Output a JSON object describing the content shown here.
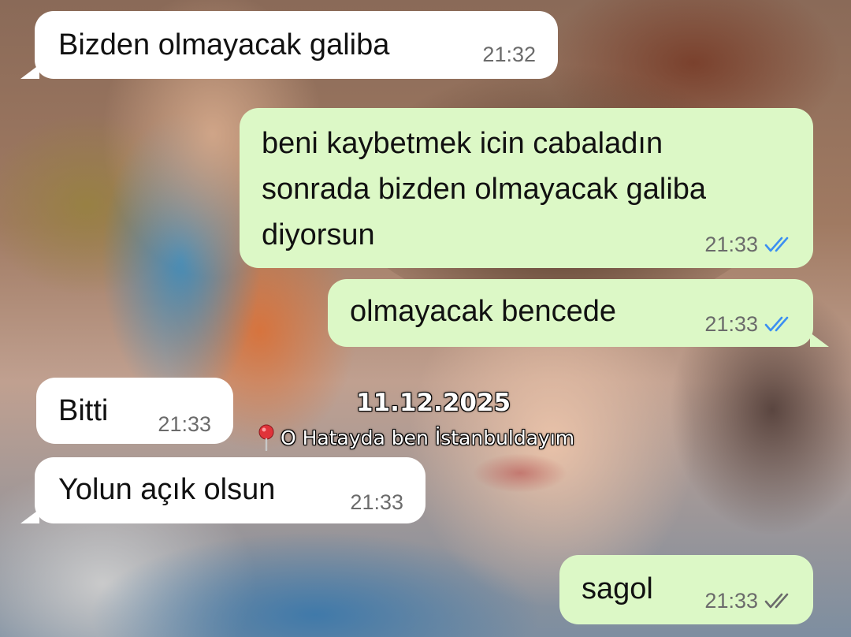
{
  "messages": [
    {
      "side": "incoming",
      "lines": [
        "Bizden olmayacak galiba"
      ],
      "time": "21:32"
    },
    {
      "side": "outgoing",
      "lines": [
        "beni kaybetmek icin cabaladın",
        "sonrada bizden olmayacak galiba",
        "diyorsun"
      ],
      "time": "21:33",
      "status": "read",
      "tick_color": "#3b8ff2"
    },
    {
      "side": "outgoing",
      "lines": [
        "olmayacak bencede"
      ],
      "time": "21:33",
      "status": "read",
      "tick_color": "#3b8ff2"
    },
    {
      "side": "incoming",
      "lines": [
        "Bitti"
      ],
      "time": "21:33"
    },
    {
      "side": "incoming",
      "lines": [
        "Yolun açık olsun"
      ],
      "time": "21:33"
    },
    {
      "side": "outgoing",
      "lines": [
        "sagol"
      ],
      "time": "21:33",
      "status": "delivered",
      "tick_color": "#6b6b6b"
    }
  ],
  "overlay": {
    "date": "11.12.2025",
    "location_icon": "pin-icon",
    "location": "O Hatayda ben İstanbuldayım"
  },
  "colors": {
    "incoming_bubble": "#ffffff",
    "outgoing_bubble": "#dcf8c6",
    "read_tick": "#3b8ff2",
    "timestamp": "#6b6b6b"
  }
}
